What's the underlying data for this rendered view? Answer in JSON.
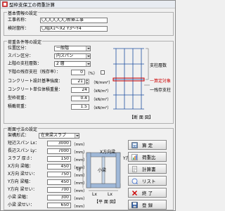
{
  "window": {
    "title": "型枠支保工の荷重計算"
  },
  "basic": {
    "group_title": "基本情報の設定",
    "project_label": "工事名称：",
    "project_value": "〇〇〇〇〇〇新築工事",
    "location_label": "検討箇所：",
    "location_value": "〇階X1～X2 Y3～Y4"
  },
  "load": {
    "group_title": "荷重条件等の設定",
    "rows": [
      {
        "label": "位置区分：",
        "value": "一般階"
      },
      {
        "label": "スパン区分：",
        "value": "内スパン"
      },
      {
        "label": "上階の支柱層数：",
        "value": "2 層"
      },
      {
        "label": "下階の残存支柱（残存率）：",
        "value": "0"
      }
    ],
    "unit_percent": "（%）",
    "concrete_label": "コンクリート設計基準強度：",
    "concrete_value": "21",
    "concrete_unit": "（N/mm²）",
    "weight_label": "コンクリート単位体積重量：",
    "weight_value": "24",
    "weight_unit": "（kN/m³）",
    "formwork_label": "型枠荷重：",
    "formwork_value": "0.4",
    "formwork_unit": "（kN/m²）",
    "live_label": "積載荷重：",
    "live_value": "1.5",
    "live_unit": "（kN/m²）",
    "diagram": {
      "support_label": "支柱層数",
      "target_label": "一算定対象",
      "remain_label": "一残存支柱",
      "caption": "【断 面 図】"
    }
  },
  "section": {
    "group_title": "断面寸法の設定",
    "rows": [
      {
        "label": "架構形式：",
        "value": "在来梁スラブ"
      },
      {
        "label": "短辺スパン Lx：",
        "value": "3000",
        "unit": "（mm）"
      },
      {
        "label": "長辺スパン Ly：",
        "value": "7000",
        "unit": "（mm）"
      },
      {
        "label": "スラブ 厚さ：",
        "value": "150",
        "unit": "（mm）"
      },
      {
        "label": "X方向 梁幅：",
        "value": "450",
        "unit": "（mm）"
      },
      {
        "label": "X方向 梁せい：",
        "value": "750",
        "unit": "（mm）"
      },
      {
        "label": "Y方向 梁幅：",
        "value": "450",
        "unit": "（mm）"
      },
      {
        "label": "Y方向 梁せい：",
        "value": "700",
        "unit": "（mm）"
      },
      {
        "label": "小梁 梁幅：",
        "value": "300",
        "unit": "（mm）"
      },
      {
        "label": "小梁 梁せい：",
        "value": "650",
        "unit": "（mm）"
      }
    ],
    "plan": {
      "x_beam": "X方向梁",
      "y_beam": "Y方向梁",
      "small_beam": "小梁",
      "lx": "Lx",
      "ly": "Ly",
      "caption": "【平 面 図】"
    }
  },
  "buttons": [
    {
      "label": "算 定",
      "icon": "calculator-icon"
    },
    {
      "label": "荷重比",
      "icon": "chart-icon"
    },
    {
      "label": "計算書",
      "icon": "document-icon"
    },
    {
      "label": "リスト",
      "icon": "list-icon"
    },
    {
      "label": "終 了",
      "icon": "close-icon"
    },
    {
      "label": "登 録",
      "icon": "save-icon"
    }
  ],
  "colors": {
    "accent_red": "#cc0000",
    "beam_fill": "#9fb8d8",
    "frame_blue": "#1f4fa0"
  }
}
